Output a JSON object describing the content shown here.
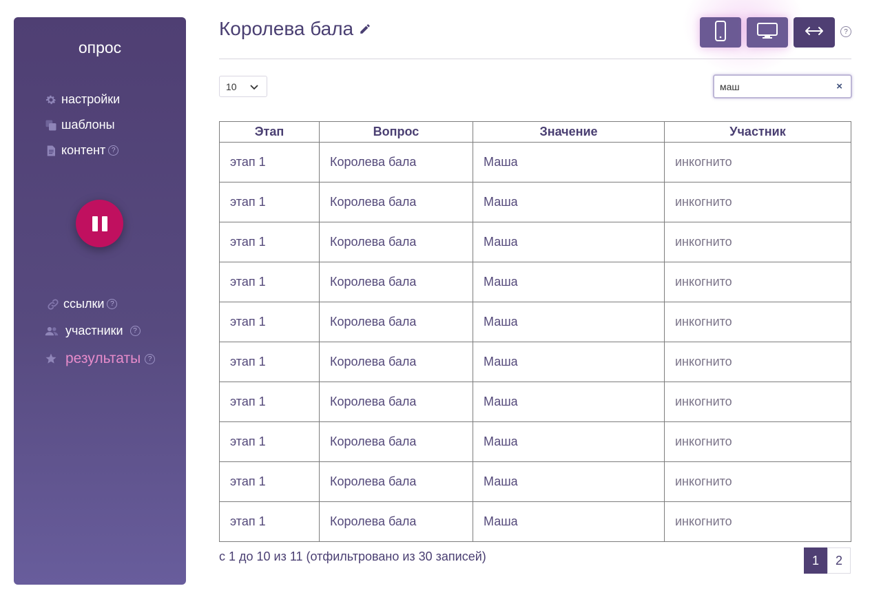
{
  "sidebar": {
    "title": "опрос",
    "items": [
      {
        "label": "настройки",
        "icon": "gear-icon"
      },
      {
        "label": "шаблоны",
        "icon": "copy-icon"
      },
      {
        "label": "контент",
        "icon": "document-icon",
        "help": "?"
      },
      {
        "label": "ссылки",
        "icon": "link-icon",
        "help": "?"
      },
      {
        "label": "участники",
        "icon": "users-icon",
        "help": "?"
      },
      {
        "label": "результаты",
        "icon": "star-icon",
        "help": "?",
        "active": true
      }
    ],
    "pause_icon": "pause-icon"
  },
  "header": {
    "title": "Королева бала",
    "edit_icon": "pencil-icon",
    "view_buttons": [
      "phone-icon",
      "desktop-icon",
      "resize-horizontal-icon"
    ],
    "help": "?"
  },
  "controls": {
    "page_length": "10",
    "search_value": "маш",
    "clear_label": "×"
  },
  "table": {
    "columns": [
      "Этап",
      "Вопрос",
      "Значение",
      "Участник"
    ],
    "rows": [
      [
        "этап 1",
        "Королева бала",
        "Маша",
        "инкогнито"
      ],
      [
        "этап 1",
        "Королева бала",
        "Маша",
        "инкогнито"
      ],
      [
        "этап 1",
        "Королева бала",
        "Маша",
        "инкогнито"
      ],
      [
        "этап 1",
        "Королева бала",
        "Маша",
        "инкогнито"
      ],
      [
        "этап 1",
        "Королева бала",
        "Маша",
        "инкогнито"
      ],
      [
        "этап 1",
        "Королева бала",
        "Маша",
        "инкогнито"
      ],
      [
        "этап 1",
        "Королева бала",
        "Маша",
        "инкогнито"
      ],
      [
        "этап 1",
        "Королева бала",
        "Маша",
        "инкогнито"
      ],
      [
        "этап 1",
        "Королева бала",
        "Маша",
        "инкогнито"
      ],
      [
        "этап 1",
        "Королева бала",
        "Маша",
        "инкогнито"
      ]
    ]
  },
  "footer": {
    "info": "с 1 до 10 из 11 (отфильтровано из 30 записей)",
    "pages": [
      "1",
      "2"
    ],
    "current_page": "1"
  },
  "colors": {
    "sidebar": "#4f3f73",
    "accent": "#c0105f",
    "active_item": "#e78ccb"
  }
}
